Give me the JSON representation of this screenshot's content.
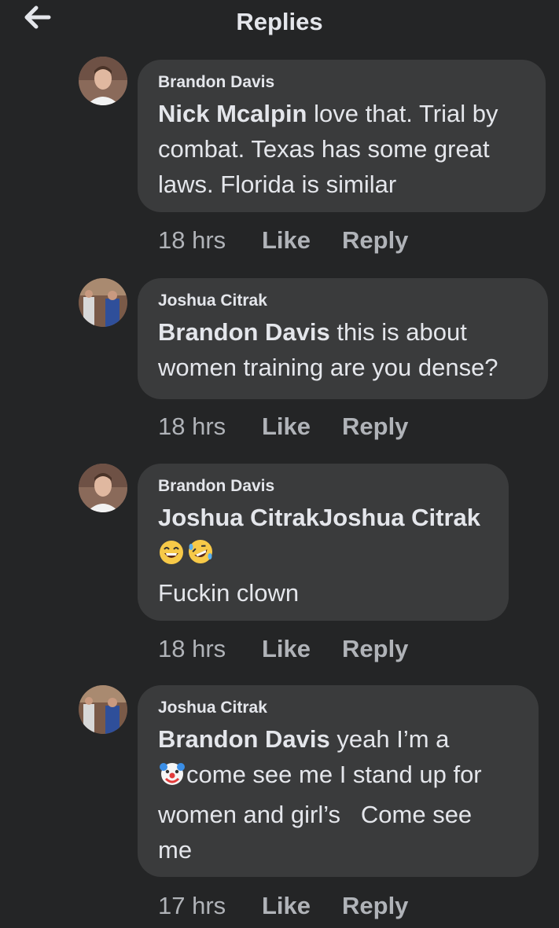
{
  "header": {
    "title": "Replies",
    "back_icon": "arrow-left-icon"
  },
  "comments": [
    {
      "author": "Brandon Davis",
      "mention": "Nick Mcalpin",
      "text_lines": [
        " love that. Trial by",
        "combat. Texas has some great",
        "laws. Florida is similar"
      ],
      "time": "18 hrs",
      "like": "Like",
      "reply": "Reply"
    },
    {
      "author": "Joshua Citrak",
      "mention": "Brandon Davis",
      "text_lines": [
        " this is about",
        "women training are you dense?"
      ],
      "time": "18 hrs",
      "like": "Like",
      "reply": "Reply"
    },
    {
      "author": "Brandon Davis",
      "mention": "Joshua CitrakJoshua Citrak",
      "emojis": [
        "grinning-face-emoji",
        "rofl-emoji"
      ],
      "text_lines": [
        "Fuckin clown"
      ],
      "time": "18 hrs",
      "like": "Like",
      "reply": "Reply"
    },
    {
      "author": "Joshua Citrak",
      "mention": "Brandon Davis",
      "text_lines": [
        " yeah I’m a",
        "come see me I stand up for",
        "women and girl’s   Come see",
        "me"
      ],
      "time": "17 hrs",
      "like": "Like",
      "reply": "Reply"
    }
  ]
}
